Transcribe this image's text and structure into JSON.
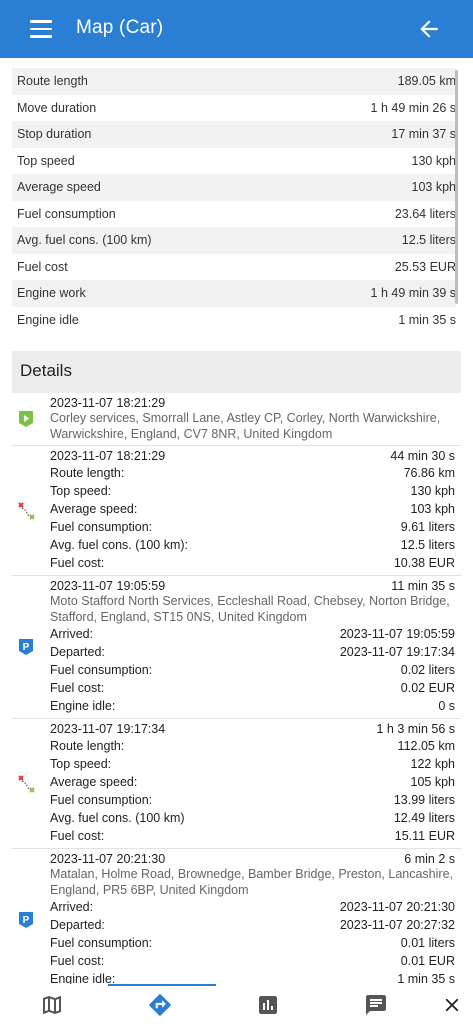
{
  "header": {
    "title": "Map (Car)"
  },
  "stats": [
    {
      "label": "Route length",
      "value": "189.05 km"
    },
    {
      "label": "Move duration",
      "value": "1 h 49 min 26 s"
    },
    {
      "label": "Stop duration",
      "value": "17 min 37 s"
    },
    {
      "label": "Top speed",
      "value": "130 kph"
    },
    {
      "label": "Average speed",
      "value": "103 kph"
    },
    {
      "label": "Fuel consumption",
      "value": "23.64 liters"
    },
    {
      "label": "Avg. fuel cons. (100 km)",
      "value": "12.5 liters"
    },
    {
      "label": "Fuel cost",
      "value": "25.53 EUR"
    },
    {
      "label": "Engine work",
      "value": "1 h 49 min 39 s"
    },
    {
      "label": "Engine idle",
      "value": "1 min 35 s"
    }
  ],
  "details_title": "Details",
  "details": [
    {
      "type": "start",
      "icon": "play-flag-icon",
      "time": "2023-11-07 18:21:29",
      "duration": "",
      "address": "Corley services, Smorrall Lane, Astley CP, Corley, North Warwickshire, Warwickshire, England, CV7 8NR, United Kingdom",
      "rows": []
    },
    {
      "type": "trip",
      "icon": "trip-route-icon",
      "time": "2023-11-07 18:21:29",
      "duration": "44 min 30 s",
      "address": "",
      "rows": [
        {
          "label": "Route length:",
          "value": "76.86 km"
        },
        {
          "label": "Top speed:",
          "value": "130 kph"
        },
        {
          "label": "Average speed:",
          "value": "103 kph"
        },
        {
          "label": "Fuel consumption:",
          "value": "9.61 liters"
        },
        {
          "label": "Avg. fuel cons. (100 km):",
          "value": "12.5 liters"
        },
        {
          "label": "Fuel cost:",
          "value": "10.38 EUR"
        }
      ]
    },
    {
      "type": "parking",
      "icon": "parking-icon",
      "time": "2023-11-07 19:05:59",
      "duration": "11 min 35 s",
      "address": "Moto Stafford North Services, Eccleshall Road, Chebsey, Norton Bridge, Stafford, England, ST15 0NS, United Kingdom",
      "rows": [
        {
          "label": "Arrived:",
          "value": "2023-11-07 19:05:59"
        },
        {
          "label": "Departed:",
          "value": "2023-11-07 19:17:34"
        },
        {
          "label": "Fuel consumption:",
          "value": "0.02 liters"
        },
        {
          "label": "Fuel cost:",
          "value": "0.02 EUR"
        },
        {
          "label": "Engine idle:",
          "value": "0 s"
        }
      ]
    },
    {
      "type": "trip",
      "icon": "trip-route-icon",
      "time": "2023-11-07 19:17:34",
      "duration": "1 h 3 min 56 s",
      "address": "",
      "rows": [
        {
          "label": "Route length:",
          "value": "112.05 km"
        },
        {
          "label": "Top speed:",
          "value": "122 kph"
        },
        {
          "label": "Average speed:",
          "value": "105 kph"
        },
        {
          "label": "Fuel consumption:",
          "value": "13.99 liters"
        },
        {
          "label": "Avg. fuel cons. (100 km)",
          "value": "12.49 liters"
        },
        {
          "label": "Fuel cost:",
          "value": "15.11 EUR"
        }
      ]
    },
    {
      "type": "parking",
      "icon": "parking-icon",
      "time": "2023-11-07 20:21:30",
      "duration": "6 min 2 s",
      "address": "Matalan, Holme Road, Brownedge, Bamber Bridge, Preston, Lancashire, England, PR5 6BP, United Kingdom",
      "rows": [
        {
          "label": "Arrived:",
          "value": "2023-11-07 20:21:30"
        },
        {
          "label": "Departed:",
          "value": "2023-11-07 20:27:32"
        },
        {
          "label": "Fuel consumption:",
          "value": "0.01 liters"
        },
        {
          "label": "Fuel cost:",
          "value": "0.01 EUR"
        },
        {
          "label": "Engine idle:",
          "value": "1 min 35 s"
        }
      ]
    }
  ],
  "bottom_nav": [
    {
      "name": "map-tab",
      "icon": "map-icon",
      "selected": false
    },
    {
      "name": "route-tab",
      "icon": "route-icon",
      "selected": true
    },
    {
      "name": "reports-tab",
      "icon": "chart-icon",
      "selected": false
    },
    {
      "name": "messages-tab",
      "icon": "message-icon",
      "selected": false
    },
    {
      "name": "close-tab",
      "icon": "close-icon",
      "selected": false
    }
  ],
  "colors": {
    "accent": "#2a7fd4",
    "start_green": "#7cc242",
    "trip_red": "#e53935",
    "trip_green": "#8bc34a"
  }
}
